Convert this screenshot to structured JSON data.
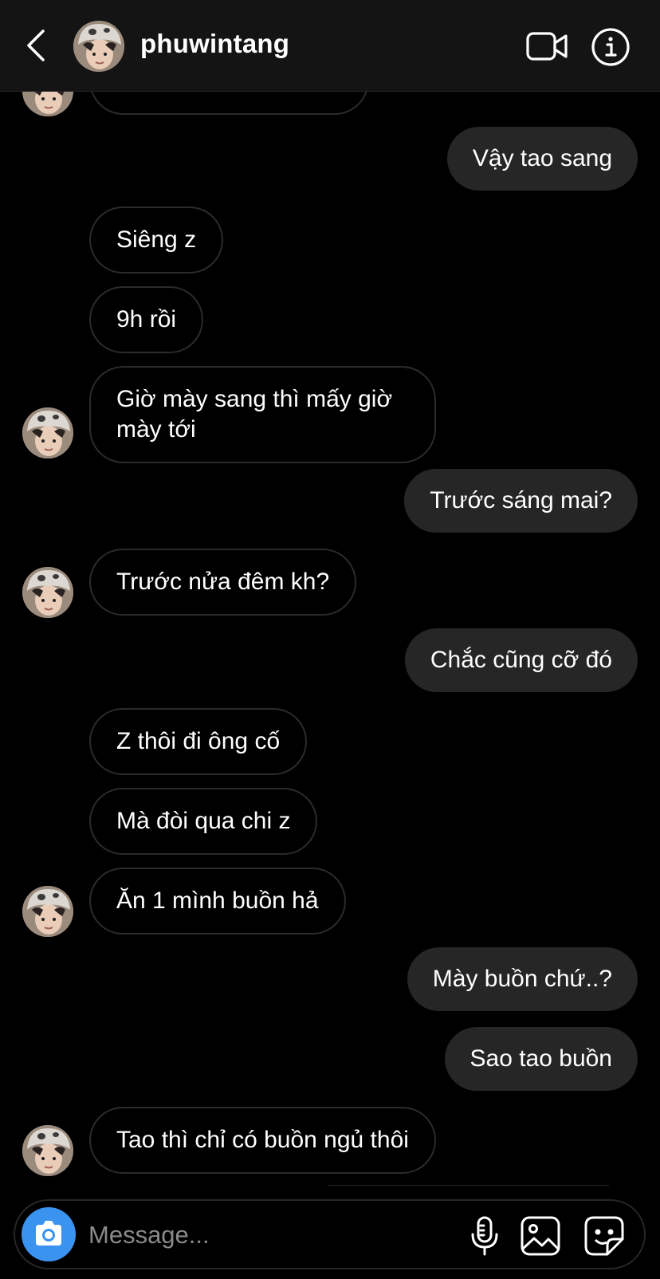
{
  "header": {
    "username": "phuwintang",
    "icons": {
      "back": "chevron-left-icon",
      "video": "video-camera-icon",
      "info": "info-icon"
    }
  },
  "messages": [
    {
      "from": "them",
      "text": ""
    },
    {
      "from": "me",
      "text": "Vậy tao sang"
    },
    {
      "from": "them",
      "text": "Siêng z"
    },
    {
      "from": "them",
      "text": "9h rồi"
    },
    {
      "from": "them",
      "text": "Giờ mày sang thì mấy giờ mày tới"
    },
    {
      "from": "me",
      "text": "Trước sáng mai?"
    },
    {
      "from": "them",
      "text": "Trước nửa đêm kh?"
    },
    {
      "from": "me",
      "text": "Chắc cũng cỡ đó"
    },
    {
      "from": "them",
      "text": "Z thôi đi ông cố"
    },
    {
      "from": "them",
      "text": "Mà đòi qua chi z"
    },
    {
      "from": "them",
      "text": "Ăn 1 mình buồn hả"
    },
    {
      "from": "me",
      "text": "Mày buồn chứ..?"
    },
    {
      "from": "me",
      "text": "Sao tao buồn"
    },
    {
      "from": "them",
      "text": "Tao thì chỉ có buồn ngủ thôi"
    }
  ],
  "composer": {
    "placeholder": "Message...",
    "icons": {
      "camera": "camera-icon",
      "mic": "microphone-icon",
      "gallery": "gallery-icon",
      "sticker": "sticker-icon"
    }
  },
  "colors": {
    "accent": "#3b93f0",
    "outgoing_bubble": "#262626",
    "incoming_border": "#2b2b2b",
    "header_bg": "#141414"
  }
}
